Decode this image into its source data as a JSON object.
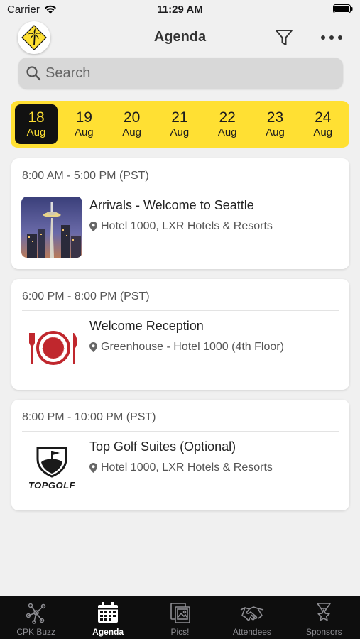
{
  "status_bar": {
    "carrier": "Carrier",
    "time": "11:29 AM"
  },
  "header": {
    "title": "Agenda"
  },
  "search": {
    "placeholder": "Search"
  },
  "dates": [
    {
      "day": "18",
      "month": "Aug",
      "selected": true
    },
    {
      "day": "19",
      "month": "Aug"
    },
    {
      "day": "20",
      "month": "Aug"
    },
    {
      "day": "21",
      "month": "Aug"
    },
    {
      "day": "22",
      "month": "Aug"
    },
    {
      "day": "23",
      "month": "Aug"
    },
    {
      "day": "24",
      "month": "Aug"
    }
  ],
  "events": [
    {
      "time": "8:00 AM - 5:00 PM (PST)",
      "title": "Arrivals - Welcome to Seattle",
      "location": "Hotel 1000, LXR Hotels & Resorts",
      "thumb": "space-needle-image"
    },
    {
      "time": "6:00 PM - 8:00 PM (PST)",
      "title": "Welcome Reception",
      "location": "Greenhouse - Hotel 1000 (4th Floor)",
      "thumb": "dining-icon"
    },
    {
      "time": "8:00 PM - 10:00 PM (PST)",
      "title": "Top Golf Suites (Optional)",
      "location": "Hotel 1000, LXR Hotels & Resorts",
      "thumb": "topgolf-logo",
      "thumb_text": "TOPGOLF"
    }
  ],
  "tabs": [
    {
      "label": "CPK Buzz",
      "icon": "network-icon"
    },
    {
      "label": "Agenda",
      "icon": "calendar-icon",
      "active": true
    },
    {
      "label": "Pics!",
      "icon": "photos-icon"
    },
    {
      "label": "Attendees",
      "icon": "handshake-icon"
    },
    {
      "label": "Sponsors",
      "icon": "award-icon"
    }
  ],
  "colors": {
    "accent_yellow": "#ffe033",
    "tab_bar": "#0e0e0e",
    "background": "#f0f0f0"
  }
}
